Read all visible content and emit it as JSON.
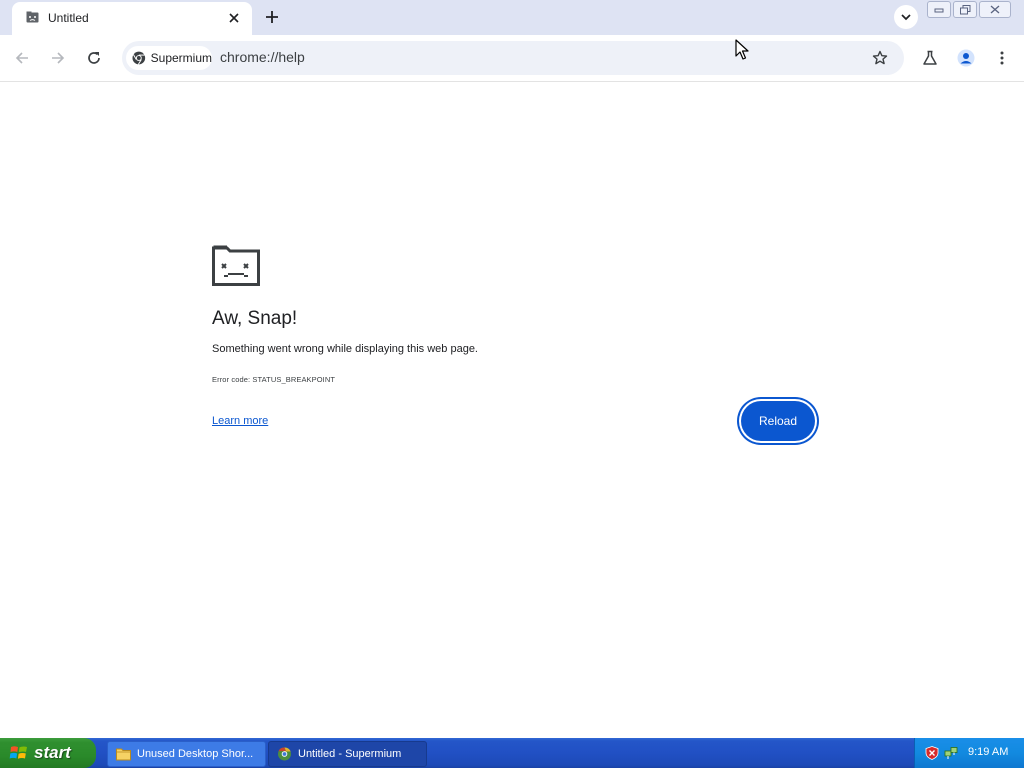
{
  "browser": {
    "tab": {
      "title": "Untitled"
    },
    "site_chip": {
      "label": "Supermium"
    },
    "address": {
      "url": "chrome://help"
    }
  },
  "error_page": {
    "title": "Aw, Snap!",
    "message": "Something went wrong while displaying this web page.",
    "error_code": "Error code: STATUS_BREAKPOINT",
    "learn_more": "Learn more",
    "reload": "Reload"
  },
  "taskbar": {
    "start_label": "start",
    "items": [
      {
        "label": "Unused Desktop Shor..."
      },
      {
        "label": "Untitled - Supermium"
      }
    ],
    "clock": "9:19 AM"
  },
  "colors": {
    "accent": "#0b57d0",
    "tabstrip": "#dee3f3",
    "taskbar": "#2150c4",
    "start": "#2f8f2f"
  }
}
